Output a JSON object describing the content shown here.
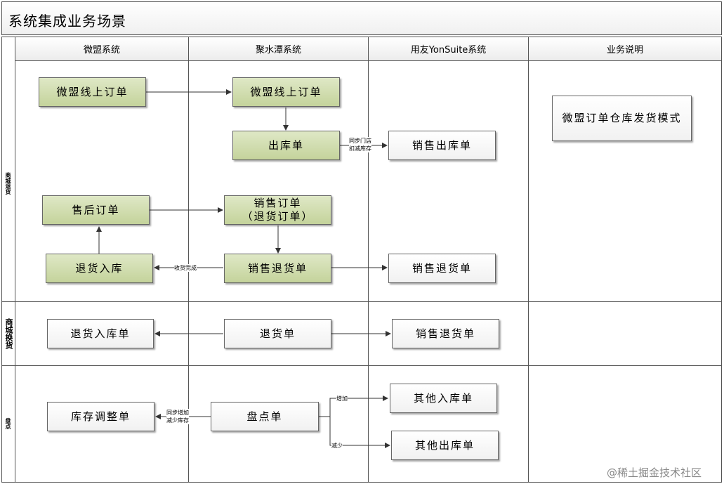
{
  "title": "系统集成业务场景",
  "columns": [
    "微盟系统",
    "聚水潭系统",
    "用友YonSuite系统",
    "业务说明"
  ],
  "lanes": [
    "商城退货",
    "商城换货",
    "盘点"
  ],
  "boxes": {
    "wm_online_order": "微盟线上订单",
    "jst_online_order": "微盟线上订单",
    "jst_outbound": "出库单",
    "ys_sales_outbound": "销售出库单",
    "wm_aftersale_order": "售后订单",
    "jst_sales_order_line1": "销售订单",
    "jst_sales_order_line2": "（退货订单）",
    "wm_return_inbound": "退货入库",
    "jst_sales_return": "销售退货单",
    "ys_sales_return": "销售退货单",
    "wm_return_inbound_doc": "退货入库单",
    "jst_return_doc": "退货单",
    "ys_sales_return_2": "销售退货单",
    "wm_stock_adjust": "库存调整单",
    "jst_stocktake": "盘点单",
    "ys_other_inbound": "其他入库单",
    "ys_other_outbound": "其他出库单",
    "desc_wm_warehouse": "微盟订单仓库发货模式"
  },
  "notes": {
    "sync_store_line1": "同步门店",
    "sync_store_line2": "扣减库存",
    "receipt_done": "收货完成",
    "sync_inc_line1": "同步增加",
    "sync_inc_line2": "减少库存",
    "increase": "增加",
    "decrease": "减少"
  },
  "watermark": "@稀土掘金技术社区",
  "colors": {
    "green_fill": "#c4d39b",
    "line": "#555555"
  }
}
